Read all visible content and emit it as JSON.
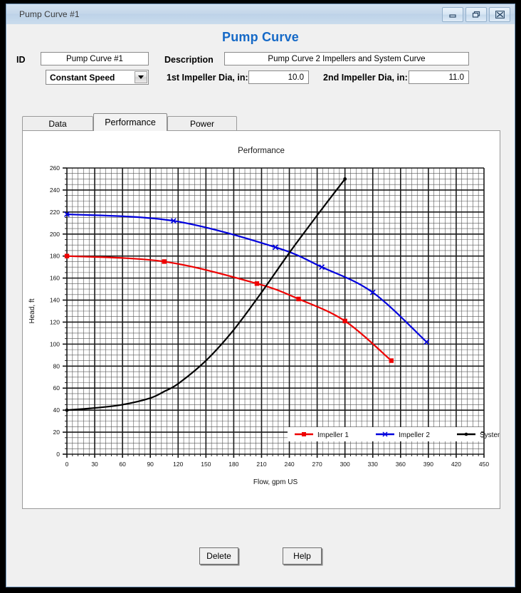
{
  "window": {
    "title": "Pump Curve #1",
    "buttons": {
      "minimize": "minimize-icon",
      "restore": "restore-icon",
      "close": "close-icon"
    }
  },
  "page": {
    "heading": "Pump Curve"
  },
  "form": {
    "id_label": "ID",
    "id_value": "Pump Curve #1",
    "description_label": "Description",
    "description_value": "Pump Curve 2 Impellers and System Curve",
    "speed_mode": "Constant Speed",
    "speed_options": [
      "Constant Speed"
    ],
    "impeller1_label": "1st Impeller Dia, in:",
    "impeller1_value": "10.0",
    "impeller2_label": "2nd Impeller Dia, in:",
    "impeller2_value": "11.0"
  },
  "tabs": [
    {
      "label": "Data",
      "active": false
    },
    {
      "label": "Performance",
      "active": true
    },
    {
      "label": "Power",
      "active": false
    }
  ],
  "footer": {
    "delete_label": "Delete",
    "help_label": "Help"
  },
  "colors": {
    "impeller1": "#ee0000",
    "impeller2": "#0000dd",
    "system": "#000000",
    "heading": "#1569c7",
    "grid_major": "#1a1a1a",
    "grid_minor": "#555555"
  },
  "chart_data": {
    "type": "line",
    "title": "Performance",
    "xlabel": "Flow, gpm US",
    "ylabel": "Head, ft",
    "xlim": [
      0,
      450
    ],
    "ylim": [
      0,
      260
    ],
    "xticks": [
      0,
      30,
      60,
      90,
      120,
      150,
      180,
      210,
      240,
      270,
      300,
      330,
      360,
      390,
      420,
      450
    ],
    "yticks": [
      0,
      20,
      40,
      60,
      80,
      100,
      120,
      140,
      160,
      180,
      200,
      220,
      240,
      260
    ],
    "x_minor_step": 6,
    "y_minor_step": 5,
    "grid": true,
    "legend_position": "bottom-right",
    "series": [
      {
        "name": "Impeller 1",
        "color": "#ee0000",
        "marker": "square",
        "points": [
          {
            "x": 0,
            "y": 180
          },
          {
            "x": 105,
            "y": 175
          },
          {
            "x": 205,
            "y": 155
          },
          {
            "x": 250,
            "y": 141
          },
          {
            "x": 300,
            "y": 121
          },
          {
            "x": 350,
            "y": 85
          }
        ]
      },
      {
        "name": "Impeller 2",
        "color": "#0000dd",
        "marker": "cross",
        "points": [
          {
            "x": 0,
            "y": 218
          },
          {
            "x": 115,
            "y": 212
          },
          {
            "x": 225,
            "y": 188
          },
          {
            "x": 275,
            "y": 170
          },
          {
            "x": 330,
            "y": 147
          },
          {
            "x": 388,
            "y": 102
          }
        ]
      },
      {
        "name": "System",
        "color": "#000000",
        "marker": "dot",
        "points": [
          {
            "x": 0,
            "y": 40
          },
          {
            "x": 30,
            "y": 42
          },
          {
            "x": 60,
            "y": 45
          },
          {
            "x": 90,
            "y": 51
          },
          {
            "x": 105,
            "y": 57
          },
          {
            "x": 120,
            "y": 64
          },
          {
            "x": 150,
            "y": 85
          },
          {
            "x": 180,
            "y": 113
          },
          {
            "x": 210,
            "y": 147
          },
          {
            "x": 240,
            "y": 183
          },
          {
            "x": 270,
            "y": 217
          },
          {
            "x": 300,
            "y": 250
          }
        ]
      }
    ]
  }
}
